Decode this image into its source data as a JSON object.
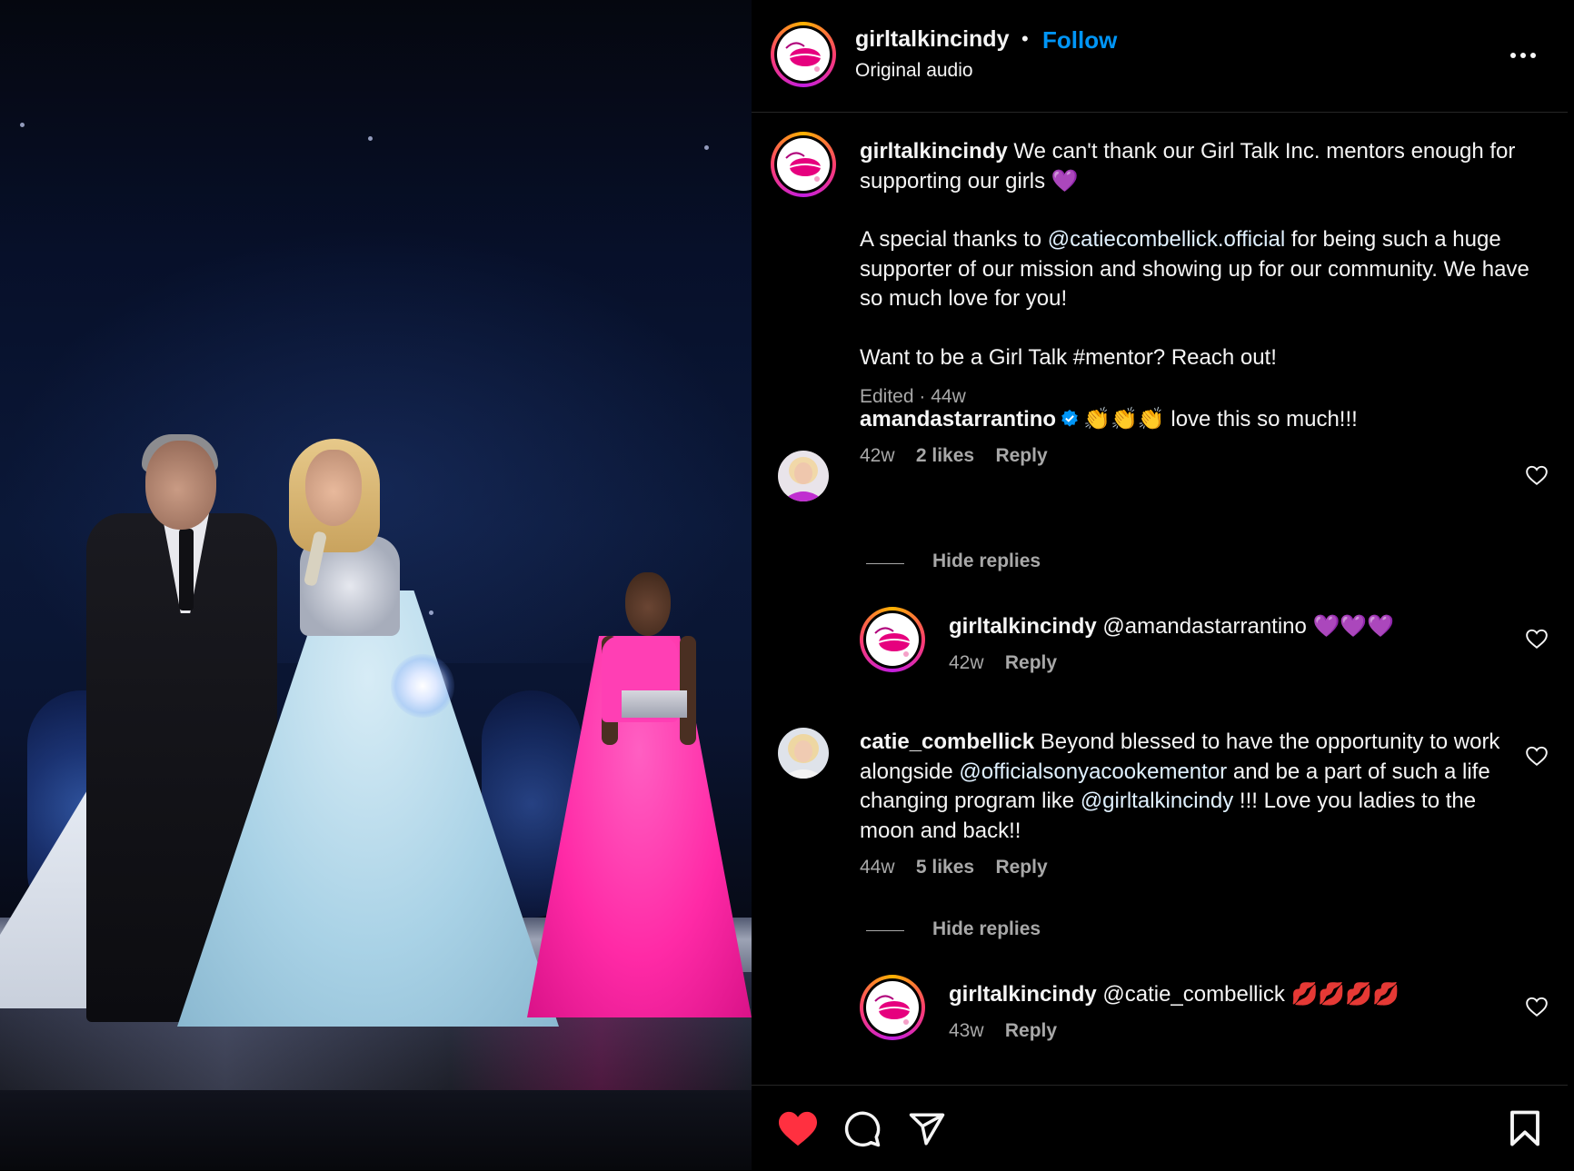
{
  "header": {
    "username": "girltalkincindy",
    "separator": "•",
    "follow_label": "Follow",
    "audio_label": "Original audio"
  },
  "caption": {
    "username": "girltalkincindy",
    "line1": "We can't thank our Girl Talk Inc. mentors enough for supporting our girls 💜",
    "p2_before": "A special thanks to ",
    "p2_mention": "@catiecombellick.official",
    "p2_after": " for being such a huge supporter of our mission and showing up for our community. We have so much love for you!",
    "p3": "Want to be a Girl Talk #mentor? Reach out!",
    "edited": "Edited",
    "dot": "·",
    "age": "44w"
  },
  "comments": [
    {
      "username": "amandastarrantino",
      "verified": true,
      "text": "👏👏👏 love this so much!!!",
      "age": "42w",
      "likes": "2 likes",
      "reply_label": "Reply",
      "hide_replies": "Hide replies",
      "reply": {
        "username": "girltalkincindy",
        "text": "@amandastarrantino 💜💜💜",
        "age": "42w",
        "reply_label": "Reply"
      }
    },
    {
      "username": "catie_combellick",
      "text_before": "Beyond blessed to have the opportunity to work alongside ",
      "mention1": "@officialsonyacookementor",
      "text_mid": " and be a part of such a life changing program like ",
      "mention2": "@girltalkincindy",
      "text_after": " !!! Love you ladies to the moon and back!!",
      "age": "44w",
      "likes": "5 likes",
      "reply_label": "Reply",
      "hide_replies": "Hide replies",
      "reply": {
        "username": "girltalkincindy",
        "text": "@catie_combellick 💋💋💋💋",
        "age": "43w",
        "reply_label": "Reply"
      }
    }
  ],
  "footer": {
    "icons": [
      "heart-filled-icon",
      "comment-icon",
      "share-icon",
      "save-icon"
    ],
    "heart_color": "#ff3040"
  },
  "colors": {
    "accent": "#0095f6",
    "background": "#000000",
    "muted": "#a8a8a8"
  }
}
